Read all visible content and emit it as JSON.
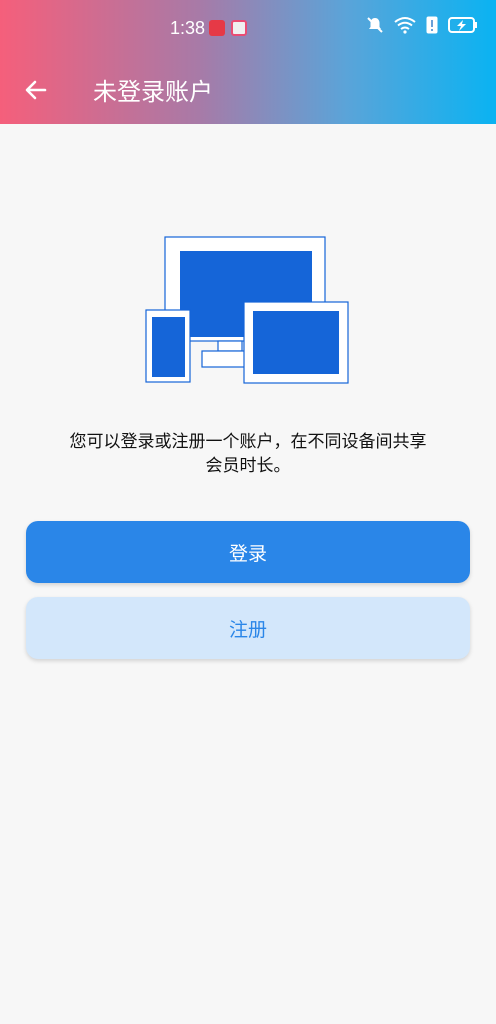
{
  "status_bar": {
    "time": "1:38"
  },
  "app_bar": {
    "title": "未登录账户",
    "back_icon": "arrow-left-icon"
  },
  "content": {
    "description": "您可以登录或注册一个账户，在不同设备间共享会员时长。",
    "illustration_icon": "multi-device-icon"
  },
  "actions": {
    "login_label": "登录",
    "register_label": "注册"
  },
  "colors": {
    "primary": "#2a86e8",
    "secondary_bg": "#d3e7fb",
    "device_blue": "#1565d8",
    "background": "#f7f7f7"
  }
}
